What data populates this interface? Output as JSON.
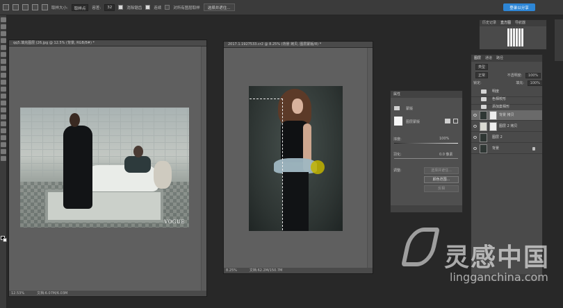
{
  "options_bar": {
    "sample_size_label": "取样大小:",
    "sample_size_value": "取样点",
    "tolerance_label": "容差:",
    "tolerance_value": "32",
    "antialias_label": "消除锯齿",
    "contiguous_label": "连续",
    "all_layers_label": "对所有图层取样",
    "select_mask_label": "选择并遮住...",
    "share_label": "登录以分享"
  },
  "doc1": {
    "tab_title": "qq5.填充图层 (26.jpg @ 12.5% (背景, RGB/8#) *",
    "zoom": "12.53%",
    "doc_info": "文档:6.07M/6.03M",
    "watermark": "VOGUE"
  },
  "doc2": {
    "tab_title": "2017.1.1927533.cr2 @ 8.25% (背景 拷贝, 图层蒙版/8) *",
    "zoom": "8.25%",
    "doc_info": "文档:62.2M/150.7M"
  },
  "properties": {
    "title": "属性",
    "section": "蒙版",
    "mask_label": "图层蒙版",
    "density_label": "浓度:",
    "density_value": "100%",
    "feather_label": "羽化:",
    "feather_value": "0.0 像素",
    "adjust_label": "调整:",
    "btn_select_mask": "选择并遮住...",
    "btn_color_range": "颜色范围...",
    "btn_invert": "反相"
  },
  "history_panel": {
    "tabs": [
      "历史记录",
      "直方图",
      "导航器"
    ]
  },
  "layers_panel": {
    "tabs": [
      "图层",
      "通道",
      "路径"
    ],
    "filter_label": "类型",
    "blend_mode": "正常",
    "opacity_label": "不透明度:",
    "opacity_value": "100%",
    "lock_label": "锁定:",
    "fill_label": "填充:",
    "fill_value": "100%",
    "layers": [
      {
        "name": "明度",
        "type": "folder"
      },
      {
        "name": "色相校形",
        "type": "folder"
      },
      {
        "name": "添加案相形",
        "type": "folder"
      },
      {
        "name": "背景 拷贝",
        "type": "masked",
        "selected": true
      },
      {
        "name": "图层 2 拷贝",
        "type": "masked"
      },
      {
        "name": "图层 2",
        "type": "pixel"
      },
      {
        "name": "背景",
        "type": "background",
        "locked": true
      }
    ]
  },
  "watermark": {
    "cn": "灵感中国",
    "en": "lingganchina.com"
  },
  "colors": {
    "workspace": "#282828",
    "panel": "#4a4a4a",
    "accent": "#2d86d6",
    "canvas_bg": "#5f5f5f"
  }
}
